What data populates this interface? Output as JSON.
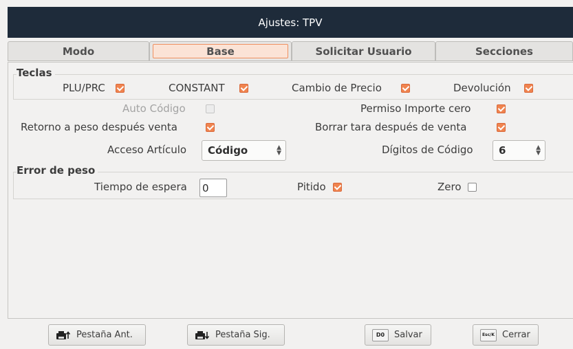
{
  "window": {
    "title": "Ajustes: TPV"
  },
  "tabs": [
    {
      "label": "Modo",
      "active": false
    },
    {
      "label": "Base",
      "active": true
    },
    {
      "label": "Solicitar Usuario",
      "active": false
    },
    {
      "label": "Secciones",
      "active": false
    }
  ],
  "teclas": {
    "title": "Teclas",
    "items": [
      {
        "label": "PLU/PRC",
        "checked": true
      },
      {
        "label": "CONSTANT",
        "checked": true
      },
      {
        "label": "Cambio de Precio",
        "checked": true
      },
      {
        "label": "Devolución",
        "checked": true
      }
    ]
  },
  "options": {
    "auto_codigo": {
      "label": "Auto Código",
      "checked": false,
      "enabled": false
    },
    "permiso_importe_cero": {
      "label": "Permiso Importe cero",
      "checked": true
    },
    "retorno_peso": {
      "label": "Retorno a peso después venta",
      "checked": true
    },
    "borrar_tara": {
      "label": "Borrar tara después de venta",
      "checked": true
    },
    "acceso_articulo": {
      "label": "Acceso Artículo",
      "value": "Código"
    },
    "digitos_codigo": {
      "label": "Dígitos de Código",
      "value": "6"
    }
  },
  "error_peso": {
    "title": "Error de peso",
    "tiempo_espera": {
      "label": "Tiempo de espera",
      "value": "0"
    },
    "pitido": {
      "label": "Pitido",
      "checked": true
    },
    "zero": {
      "label": "Zero",
      "checked": false
    }
  },
  "buttons": {
    "prev_tab": {
      "label": "Pestaña Ant.",
      "icon": "printer-up-icon"
    },
    "next_tab": {
      "label": "Pestaña Sig.",
      "icon": "printer-down-icon"
    },
    "save": {
      "label": "Salvar",
      "key": "D0"
    },
    "close": {
      "label": "Cerrar",
      "key": "Esc/K"
    }
  },
  "colors": {
    "accent": "#f0844f",
    "titlebar": "#1e2b3a",
    "tab_active_bg": "#fbe3d6"
  }
}
